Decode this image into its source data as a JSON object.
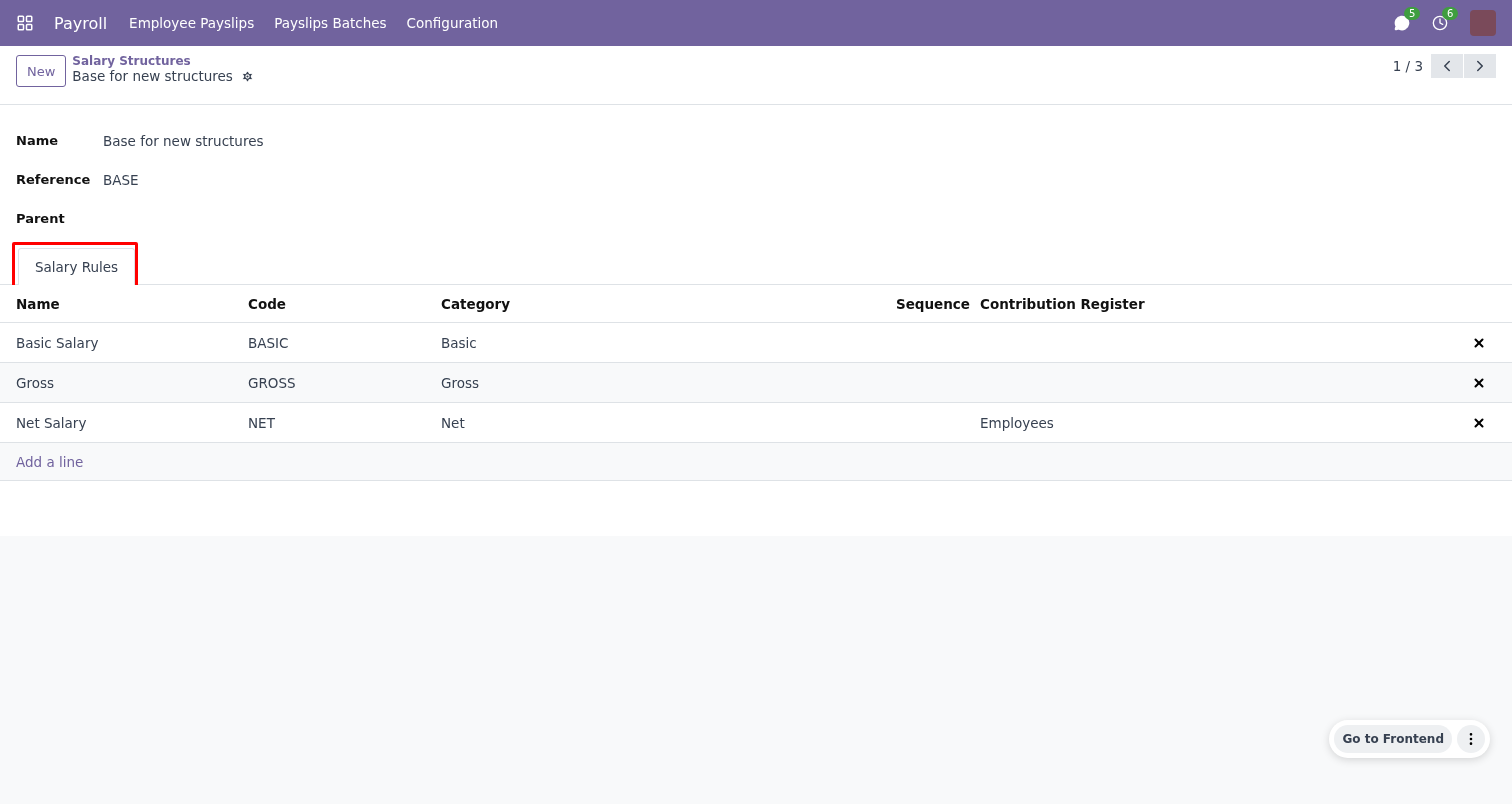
{
  "navbar": {
    "app": "Payroll",
    "menu": [
      "Employee Payslips",
      "Payslips Batches",
      "Configuration"
    ],
    "messages_count": "5",
    "activities_count": "6"
  },
  "control_panel": {
    "new_button": "New",
    "breadcrumb": "Salary Structures",
    "record": "Base for new structures",
    "pager": "1 / 3"
  },
  "fields": [
    {
      "label": "Name",
      "value": "Base for new structures"
    },
    {
      "label": "Reference",
      "value": "BASE"
    },
    {
      "label": "Parent"
    }
  ],
  "tabs": [
    {
      "label": "Salary Rules",
      "selected": true,
      "highlighted": true
    }
  ],
  "table": {
    "columns": [
      "Name",
      "Code",
      "Category",
      "Sequence",
      "Contribution Register"
    ],
    "rows": [
      [
        "Basic Salary",
        "BASIC",
        "Basic",
        "",
        ""
      ],
      [
        "Gross",
        "GROSS",
        "Gross",
        "",
        ""
      ],
      [
        "Net Salary",
        "NET",
        "Net",
        "",
        "Employees"
      ]
    ],
    "add_line": "Add a line"
  },
  "floating": {
    "button": "Go to Frontend"
  }
}
